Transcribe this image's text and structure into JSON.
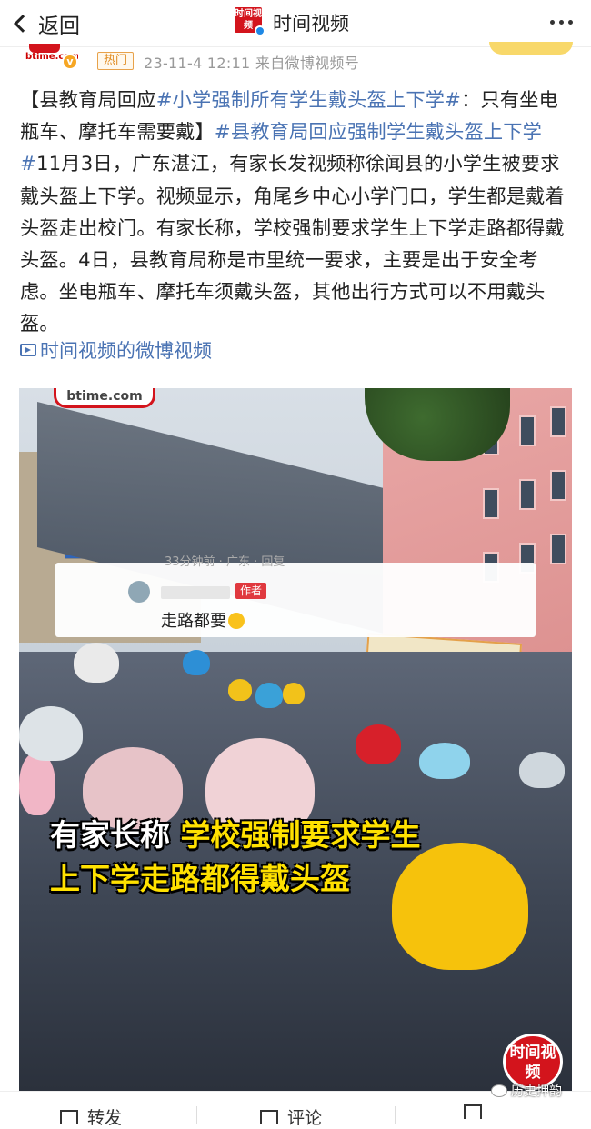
{
  "nav": {
    "back_label": "返回",
    "account_logo_text": "时间视频",
    "title": "时间视频"
  },
  "post_meta": {
    "avatar_text": "btime.com",
    "hot_badge": "热门",
    "time_source": "23-11-4 12:11  来自微博视频号"
  },
  "post": {
    "lead": "【县教育局回应",
    "topic1": "#小学强制所有学生戴头盔上下学#",
    "mid1": "：只有坐电瓶车、摩托车需要戴】",
    "topic2": "#县教育局回应强制学生戴头盔上下学#",
    "body": "11月3日，广东湛江，有家长发视频称徐闻县的小学生被要求戴头盔上下学。视频显示，角尾乡中心小学门口，学生都是戴着头盔走出校门。有家长称，学校强制要求学生上下学走路都得戴头盔。4日，县教育局称是市里统一要求，主要是出于安全考虑。坐电瓶车、摩托车须戴头盔，其他出行方式可以不用戴头盔。",
    "video_link": "时间视频的微博视频"
  },
  "video": {
    "site_badge": "btime.com",
    "comment_ghost": "33分钟前 · 广东 · 回复",
    "comment_author_tag": "作者",
    "comment_text": "走路都要",
    "caption_white": "有家长称 ",
    "caption_yellow1": "学校强制要求学生",
    "caption_yellow2": "上下学走路都得戴头盔",
    "watermark": "时间视频"
  },
  "bottom": {
    "repost": "转发",
    "comment": "评论",
    "like": "",
    "source_mark": "历史押韵"
  }
}
